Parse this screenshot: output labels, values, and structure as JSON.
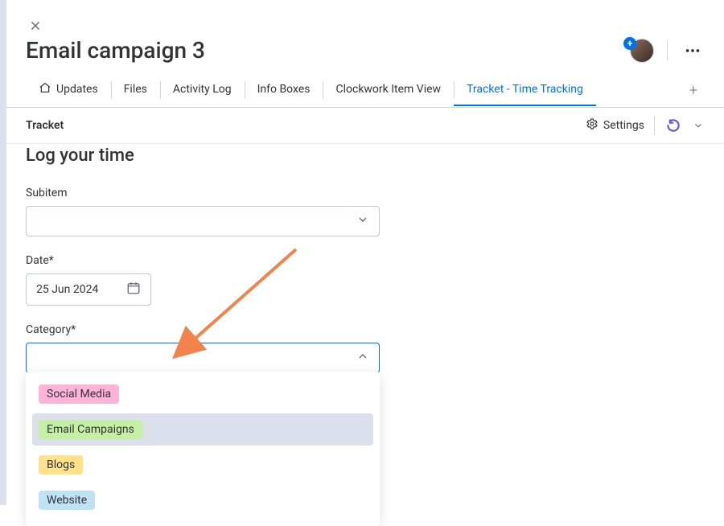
{
  "header": {
    "title": "Email campaign 3"
  },
  "tabs": [
    {
      "label": "Updates",
      "hasHomeIcon": true
    },
    {
      "label": "Files"
    },
    {
      "label": "Activity Log"
    },
    {
      "label": "Info Boxes"
    },
    {
      "label": "Clockwork Item View"
    },
    {
      "label": "Tracket - Time Tracking",
      "active": true
    }
  ],
  "subheader": {
    "app_name": "Tracket",
    "settings_label": "Settings"
  },
  "form": {
    "section_title": "Log your time",
    "subitem_label": "Subitem",
    "date_label": "Date*",
    "date_value": "25 Jun 2024",
    "category_label": "Category*"
  },
  "category_options": [
    {
      "label": "Social Media",
      "bg": "#ffb3d9"
    },
    {
      "label": "Email Campaigns",
      "bg": "#c5f0a4",
      "hover": true
    },
    {
      "label": "Blogs",
      "bg": "#ffe28a"
    },
    {
      "label": "Website",
      "bg": "#bfe3f5"
    }
  ],
  "colors": {
    "accent": "#0073ea",
    "arrow": "#f2844b"
  }
}
